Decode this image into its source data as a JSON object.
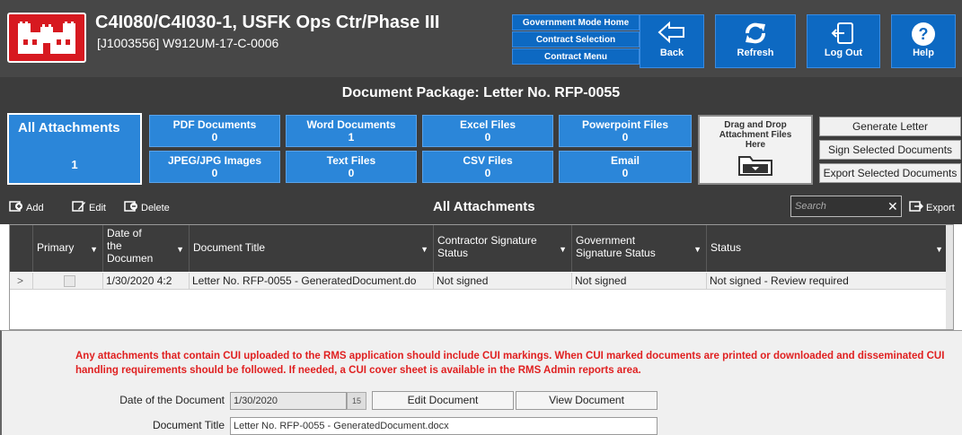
{
  "header": {
    "title": "C4I080/C4I030-1, USFK Ops Ctr/Phase III",
    "subtitle": "[J1003556] W912UM-17-C-0006",
    "nav_links": [
      "Government Mode Home",
      "Contract Selection",
      "Contract Menu"
    ],
    "buttons": {
      "back": "Back",
      "refresh": "Refresh",
      "logout": "Log Out",
      "help": "Help"
    }
  },
  "package": {
    "title": "Document Package: Letter No. RFP-0055"
  },
  "tiles": {
    "all": {
      "label": "All Attachments",
      "count": "1"
    },
    "pdf": {
      "label": "PDF Documents",
      "count": "0"
    },
    "word": {
      "label": "Word Documents",
      "count": "1"
    },
    "excel": {
      "label": "Excel Files",
      "count": "0"
    },
    "ppt": {
      "label": "Powerpoint Files",
      "count": "0"
    },
    "jpeg": {
      "label": "JPEG/JPG Images",
      "count": "0"
    },
    "text": {
      "label": "Text Files",
      "count": "0"
    },
    "csv": {
      "label": "CSV Files",
      "count": "0"
    },
    "email": {
      "label": "Email",
      "count": "0"
    },
    "dropzone": "Drag and Drop Attachment Files Here"
  },
  "actions": {
    "generate": "Generate Letter",
    "sign": "Sign Selected Documents",
    "export_selected": "Export Selected Documents"
  },
  "toolbar": {
    "add": "Add",
    "edit": "Edit",
    "delete": "Delete",
    "title": "All Attachments",
    "search_placeholder": "Search",
    "export": "Export"
  },
  "grid": {
    "columns": [
      "Primary",
      "Date of the Documen",
      "Document Title",
      "Contractor Signature Status",
      "Government Signature Status",
      "Status"
    ],
    "rows": [
      {
        "primary": false,
        "date": "1/30/2020 4:2",
        "title": "Letter No. RFP-0055  - GeneratedDocument.do",
        "contractor_status": "Not signed",
        "government_status": "Not signed",
        "status": "Not signed - Review required"
      }
    ]
  },
  "notice": "Any attachments that contain CUI uploaded to the RMS application should include CUI markings. When CUI marked documents are printed or downloaded and disseminated CUI handling requirements should be followed. If needed, a CUI cover sheet is available in the RMS Admin reports area.",
  "form": {
    "date_label": "Date of the Document",
    "date_value": "1/30/2020",
    "calendar_day": "15",
    "edit_button": "Edit Document",
    "view_button": "View Document",
    "title_label": "Document Title",
    "title_value": "Letter No. RFP-0055  - GeneratedDocument.docx"
  },
  "colors": {
    "header_bg": "#474747",
    "tile_blue": "#2b86d9",
    "nav_blue": "#0d69c2",
    "logo_red": "#d71920",
    "warning_red": "#e02020"
  }
}
